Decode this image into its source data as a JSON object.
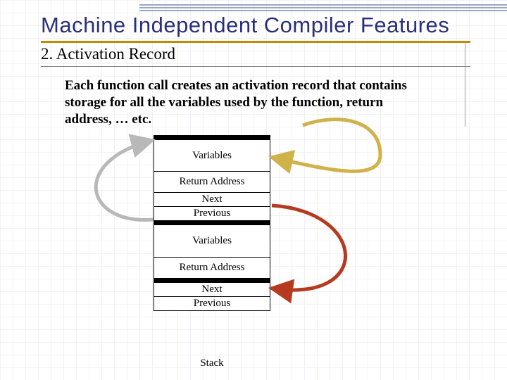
{
  "title": "Machine Independent Compiler Features",
  "subtitle": "2. Activation Record",
  "body": "Each function call creates an activation record that contains storage for all the variables used by the function, return address, … etc.",
  "stack": {
    "rows": [
      "Variables",
      "Return Address",
      "Next",
      "Previous",
      "Variables",
      "Return Address",
      "Next",
      "Previous"
    ],
    "caption": "Stack"
  },
  "arrows": [
    {
      "name": "yellow-arc",
      "color": "#d0b24a",
      "from": "body-text-variables",
      "to": "stack-variables-top"
    },
    {
      "name": "gray-arc",
      "color": "#b8b8b8",
      "from": "stack-previous-1",
      "to": "stack-top-cap"
    },
    {
      "name": "red-arc",
      "color": "#b63a20",
      "from": "stack-next-1",
      "to": "stack-return-address-2"
    }
  ]
}
